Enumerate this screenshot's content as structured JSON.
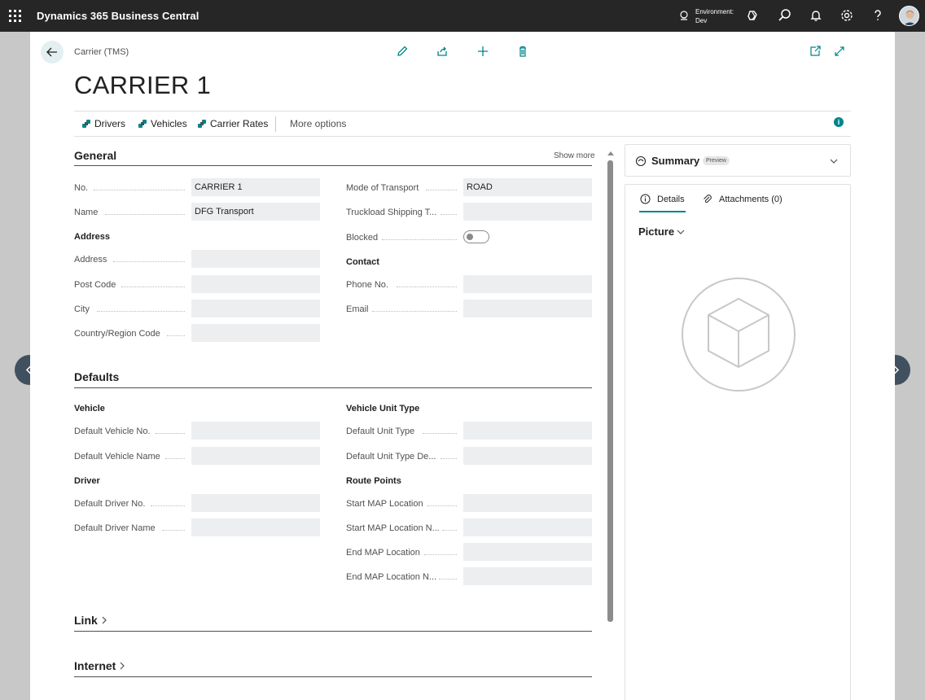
{
  "topbar": {
    "app_name": "Dynamics 365 Business Central",
    "environment_label": "Environment:",
    "environment_value": "Dev"
  },
  "page": {
    "breadcrumb": "Carrier (TMS)",
    "title": "CARRIER 1"
  },
  "actionbar": {
    "items": [
      {
        "label": "Drivers"
      },
      {
        "label": "Vehicles"
      },
      {
        "label": "Carrier Rates"
      }
    ],
    "more": "More options"
  },
  "general": {
    "title": "General",
    "show_more": "Show more",
    "no_label": "No.",
    "no_value": "CARRIER 1",
    "name_label": "Name",
    "name_value": "DFG Transport",
    "address_group": "Address",
    "address_label": "Address",
    "address_value": "",
    "post_code_label": "Post Code",
    "post_code_value": "",
    "city_label": "City",
    "city_value": "",
    "country_label": "Country/Region Code",
    "country_value": "",
    "mode_label": "Mode of Transport",
    "mode_value": "ROAD",
    "truckload_label": "Truckload Shipping T...",
    "truckload_value": "",
    "blocked_label": "Blocked",
    "blocked_value": false,
    "contact_group": "Contact",
    "phone_label": "Phone No.",
    "phone_value": "",
    "email_label": "Email",
    "email_value": ""
  },
  "defaults": {
    "title": "Defaults",
    "vehicle_group": "Vehicle",
    "def_vehicle_no_label": "Default Vehicle No.",
    "def_vehicle_name_label": "Default Vehicle Name",
    "driver_group": "Driver",
    "def_driver_no_label": "Default Driver No.",
    "def_driver_name_label": "Default Driver Name",
    "unit_type_group": "Vehicle Unit Type",
    "def_unit_type_label": "Default Unit Type",
    "def_unit_type_desc_label": "Default Unit Type De...",
    "route_group": "Route Points",
    "start_map_label": "Start MAP Location",
    "start_map_name_label": "Start MAP Location N...",
    "end_map_label": "End MAP Location",
    "end_map_name_label": "End MAP Location N..."
  },
  "link": {
    "title": "Link"
  },
  "internet": {
    "title": "Internet"
  },
  "factbox": {
    "summary_title": "Summary",
    "preview_badge": "Preview",
    "tab_details": "Details",
    "tab_attachments": "Attachments (0)",
    "picture_title": "Picture"
  },
  "colors": {
    "topbar": "#262626",
    "accent": "#008489",
    "nav_arrow": "#40505f"
  }
}
